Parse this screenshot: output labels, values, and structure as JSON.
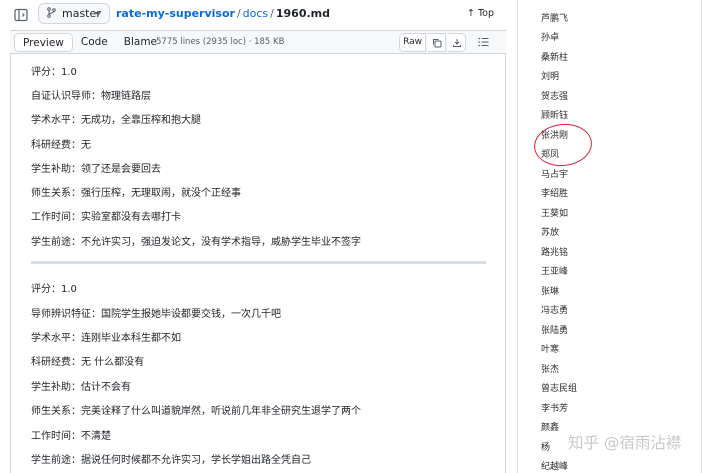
{
  "topbar": {
    "branch": "master",
    "repo": "rate-my-supervisor",
    "folder": "docs",
    "file": "1960.md",
    "top_label": "Top"
  },
  "file_header": {
    "tabs": [
      "Preview",
      "Code",
      "Blame"
    ],
    "active_tab": "Preview",
    "meta": "5775 lines (2935 loc) · 185 KB",
    "raw_label": "Raw"
  },
  "reviews": [
    {
      "lines": [
        "评分：1.0",
        "自证认识导师：物理链路层",
        "学术水平：无成功，全靠压榨和抱大腿",
        "科研经费：无",
        "学生补助：领了还是会要回去",
        "师生关系：强行压榨，无理取闹，就没个正经事",
        "工作时间：实验室都没有去哪打卡",
        "学生前途：不允许实习，强迫发论文，没有学术指导，威胁学生毕业不签字"
      ]
    },
    {
      "lines": [
        "评分：1.0",
        "导师辨识特征：国院学生报她毕设都要交钱，一次几千吧",
        "学术水平：连刚毕业本科生都不如",
        "科研经费：无 什么都没有",
        "学生补助：估计不会有",
        "师生关系：完美诠释了什么叫道貌岸然，听说前几年非全研究生退学了两个",
        "工作时间：不清楚",
        "学生前途：据说任何时候都不允许实习，学长学姐出路全凭自己"
      ]
    }
  ],
  "names_panel": {
    "names": [
      "芦鹏飞",
      "孙卓",
      "桑新柱",
      "刘明",
      "贺志强",
      "顾昕钰",
      "张洪刚",
      "郑凤",
      "马占宇",
      "李绍胜",
      "王葵如",
      "苏放",
      "路兆铭",
      "王亚峰",
      "张琳",
      "冯志勇",
      "张陆勇",
      "叶寒",
      "张杰",
      "曾志民组",
      "李书芳",
      "颜鑫",
      "杨",
      "纪越峰"
    ],
    "highlight_color": "#d6223a"
  },
  "watermark": "知乎 @宿雨沾襟",
  "colors": {
    "link": "#0969da",
    "border": "#d0d7de",
    "header_bg": "#f6f8fa"
  }
}
